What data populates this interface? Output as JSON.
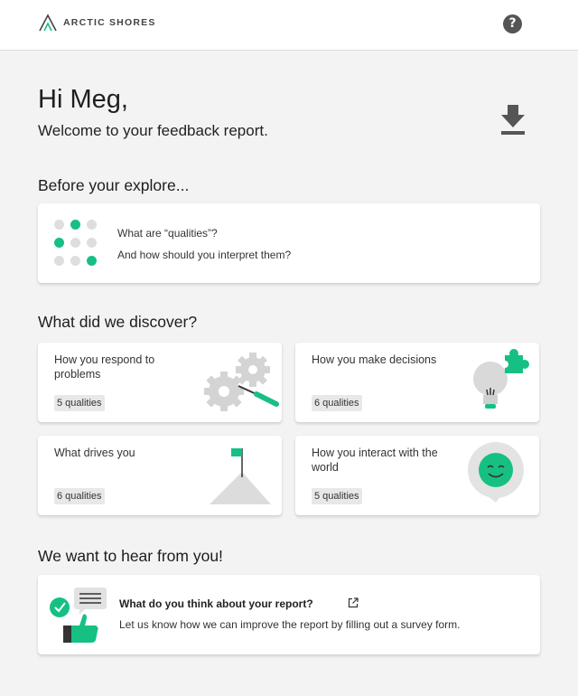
{
  "header": {
    "logo_text": "ARCTIC SHORES",
    "logo_icon": "mountain-logo-icon",
    "help_icon": "help-icon",
    "help_glyph": "?"
  },
  "intro": {
    "greeting": "Hi Meg,",
    "welcome": "Welcome to your feedback report.",
    "download_icon": "download-icon"
  },
  "explore": {
    "title": "Before your explore...",
    "line1": "What are “qualities”?",
    "line2": "And how should you interpret them?"
  },
  "discover": {
    "title": "What did we discover?",
    "cards": [
      {
        "title": "How you respond to problems",
        "badge": "5 qualities",
        "icon": "gears-wrench-icon"
      },
      {
        "title": "How you make decisions",
        "badge": "6 qualities",
        "icon": "lightbulb-puzzle-icon"
      },
      {
        "title": "What drives you",
        "badge": "6 qualities",
        "icon": "mountain-flag-icon"
      },
      {
        "title": "How you interact with the world",
        "badge": "5 qualities",
        "icon": "smiley-bubble-icon"
      }
    ]
  },
  "feedback": {
    "title": "We want to hear from you!",
    "card_title": "What do you think about your report?",
    "card_text": "Let us know how we can improve the report by filling out a survey form.",
    "icon": "thumbs-up-chat-icon",
    "external_icon": "external-link-icon"
  },
  "colors": {
    "accent": "#16c083",
    "background": "#f3f3f3",
    "card": "#ffffff",
    "text": "#222222",
    "badge": "#e8e8e8"
  }
}
